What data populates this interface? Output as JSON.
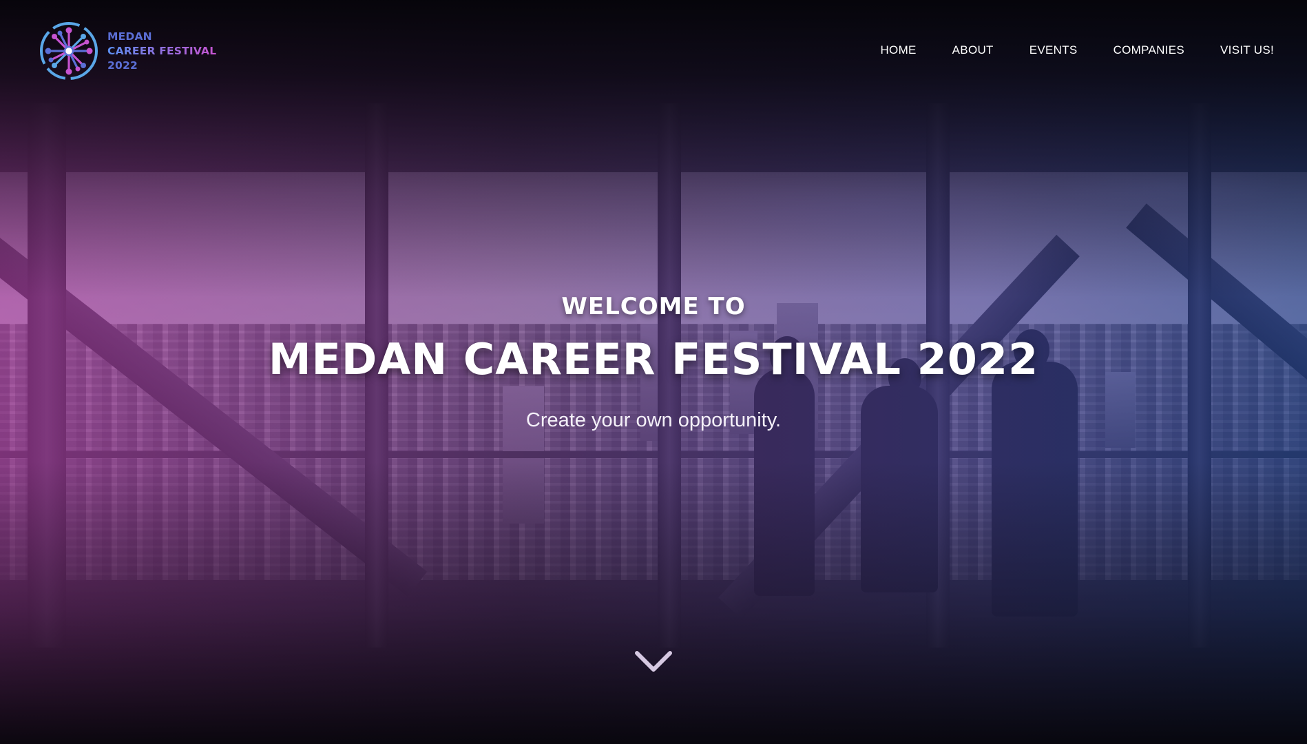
{
  "brand": {
    "line1": "MEDAN",
    "line2": "CAREER FESTIVAL",
    "line3": "2022",
    "icon": "starburst-logo-icon",
    "colors": {
      "blue": "#5b6fd6",
      "pink": "#c653d0",
      "light_blue": "#5aa7e8"
    }
  },
  "nav": {
    "items": [
      {
        "label": "HOME"
      },
      {
        "label": "ABOUT"
      },
      {
        "label": "EVENTS"
      },
      {
        "label": "COMPANIES"
      },
      {
        "label": "VISIT US!"
      }
    ]
  },
  "hero": {
    "welcome": "WELCOME TO",
    "title": "MEDAN CAREER FESTIVAL 2022",
    "tagline": "Create your own opportunity.",
    "scroll_icon": "chevron-down-icon",
    "overlay_colors": [
      "#c846be",
      "#5a5ac8",
      "#2850aa"
    ]
  }
}
